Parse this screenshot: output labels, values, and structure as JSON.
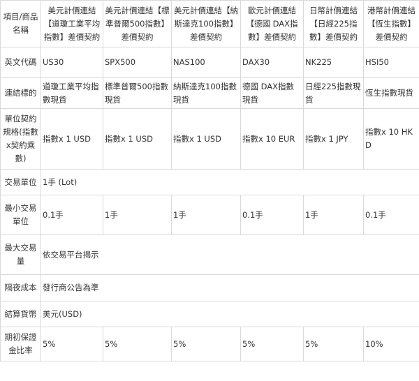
{
  "table": {
    "header": {
      "label": "項目/商品名稱",
      "columns": [
        "美元計價連結【道瓊工業平均指數】差價契約",
        "美元計價連結【標準普爾500指數】差價契約",
        "美元計價連結【納斯達克100指數】差價契約",
        "歐元計價連結【德國 DAX指數】差價契約",
        "日幣計價連結【日經225指數】差價契約",
        "港幣計價連結【恆生指數】差價契約"
      ]
    },
    "rows": {
      "code": {
        "label": "英文代碼",
        "values": [
          "US30",
          "SPX500",
          "NAS100",
          "DAX30",
          "NK225",
          "HSI50"
        ]
      },
      "basis": {
        "label": "連結標的",
        "values": [
          "道瓊工業平均指數現貨",
          "標準普爾500指數現貨",
          "納斯達克100指數現貨",
          "德國 DAX指數現貨",
          "日經225指數現貨",
          "恆生指數現貨"
        ]
      },
      "spec": {
        "label": "單位契約規格(指數x契約乘數)",
        "values": [
          "指數x 1 USD",
          "指數x 1 USD",
          "指數x 1 USD",
          "指數x 10 EUR",
          "指數x 1 JPY",
          "指數x 10 HKD"
        ]
      },
      "unit": {
        "label": "交易單位",
        "value": "1手 (Lot)"
      },
      "min": {
        "label": "最小交易單位",
        "values": [
          "0.1手",
          "1手",
          "1手",
          "0.1手",
          "1手",
          "0.1手"
        ]
      },
      "max": {
        "label": "最大交易量",
        "value": "依交易平台揭示"
      },
      "cost": {
        "label": "隔夜成本",
        "value": "發行商公告為準"
      },
      "currency": {
        "label": "結算貨幣",
        "value": "美元(USD)"
      },
      "margin": {
        "label": "期初保證金比率",
        "values": [
          "5%",
          "5%",
          "5%",
          "5%",
          "5%",
          "10%"
        ]
      }
    }
  }
}
